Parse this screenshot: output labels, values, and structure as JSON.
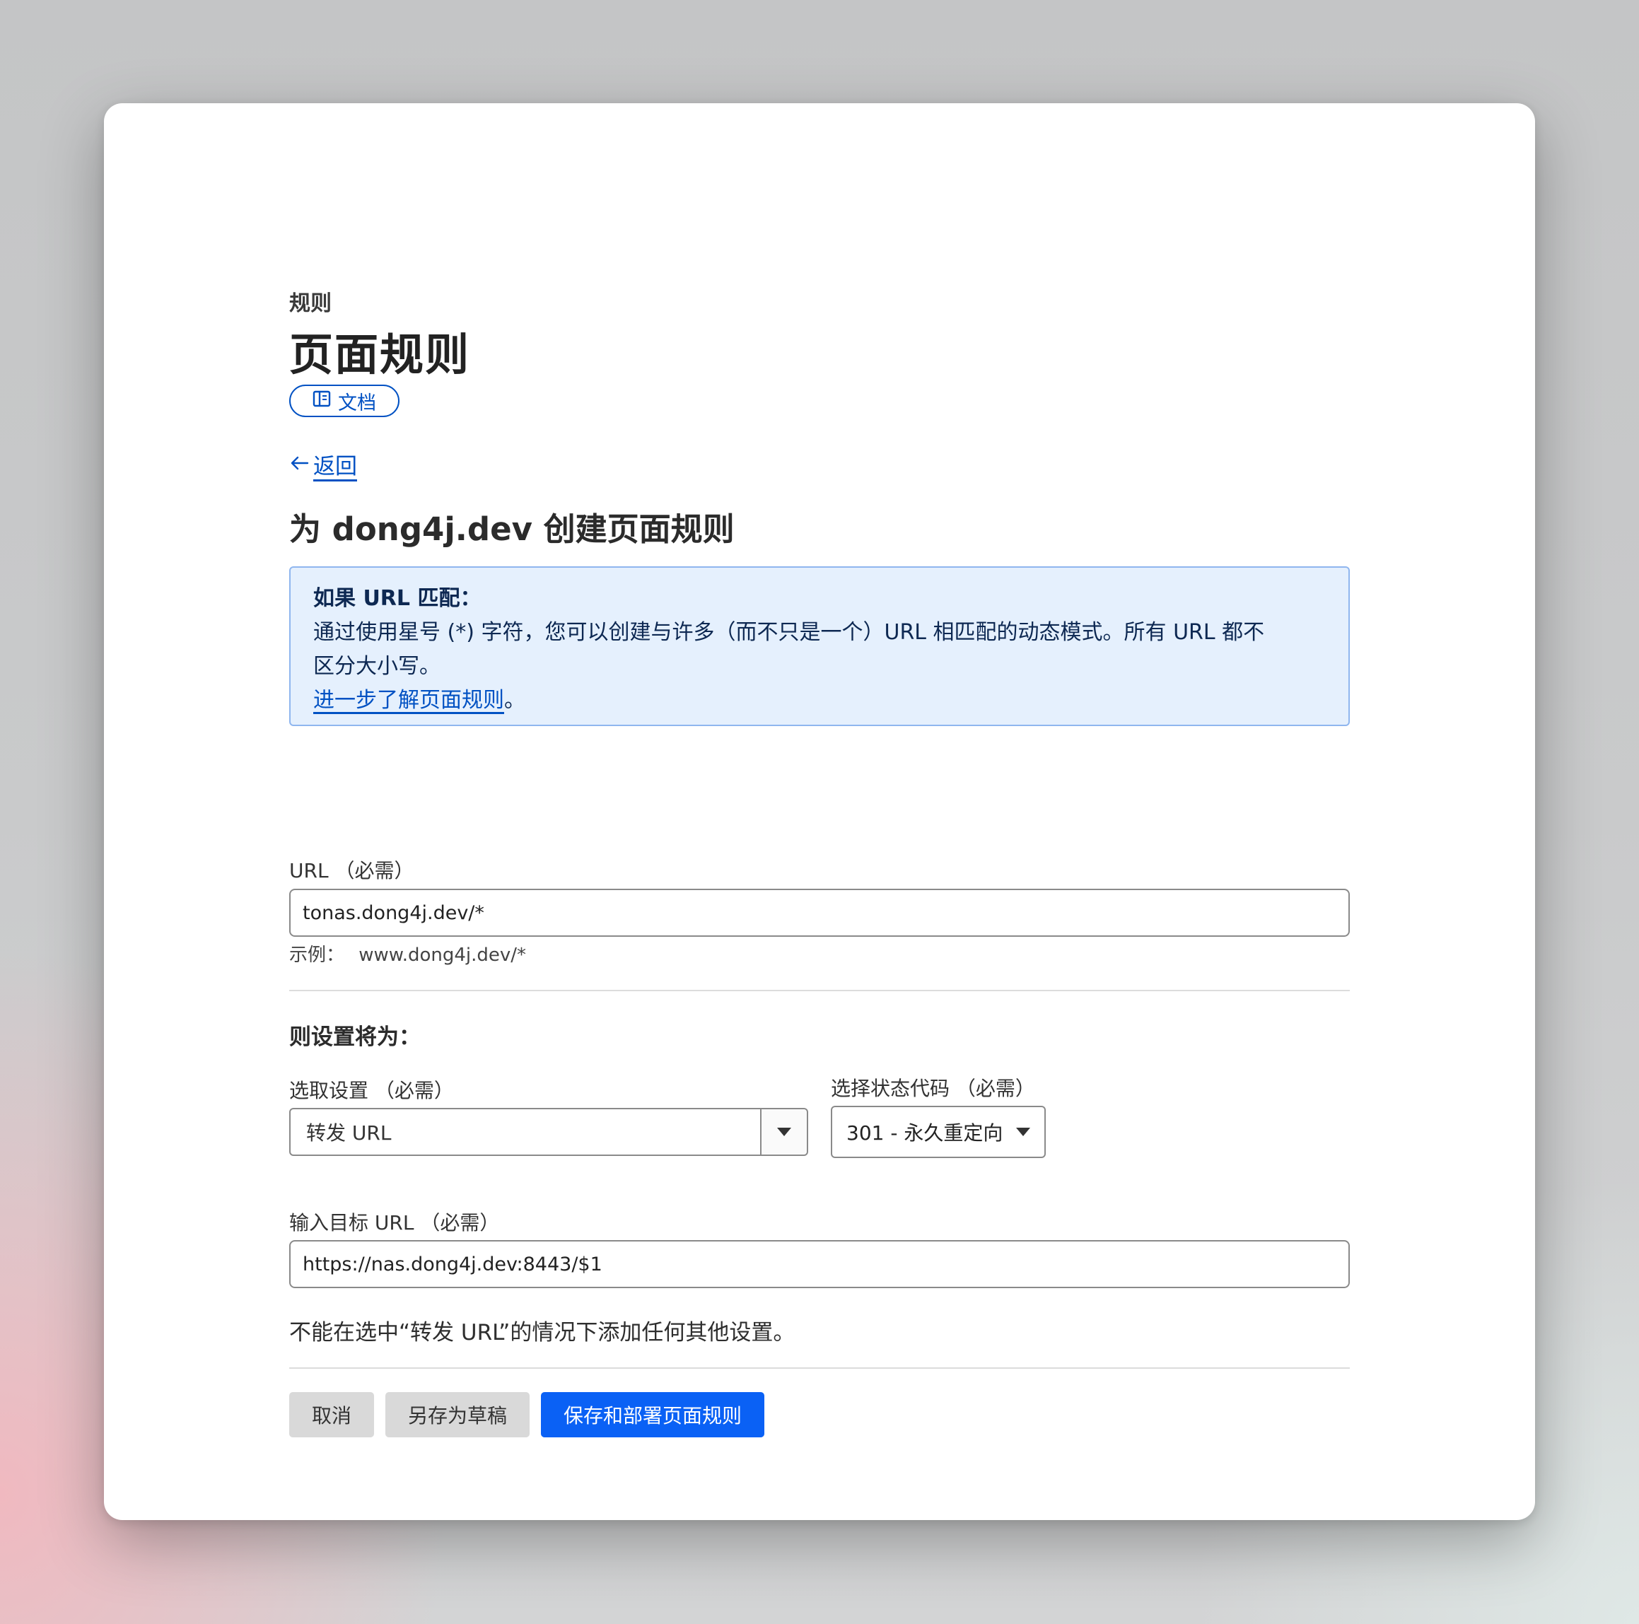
{
  "header": {
    "breadcrumb": "规则",
    "title": "页面规则",
    "docs_label": "文档",
    "back_label": "返回"
  },
  "form": {
    "heading": "为 dong4j.dev 创建页面规则",
    "info": {
      "title": "如果 URL 匹配：",
      "body_line1": "通过使用星号 (*) 字符，您可以创建与许多（而不只是一个）URL 相匹配的动态模式。所有 URL 都不",
      "body_line2": "区分大小写。",
      "link_text": "进一步了解页面规则",
      "link_suffix": "。"
    },
    "url": {
      "label": "URL （必需）",
      "value": "tonas.dong4j.dev/*",
      "example_prefix": "示例：",
      "example_value": "www.dong4j.dev/*"
    },
    "settings_heading": "则设置将为：",
    "setting": {
      "label": "选取设置 （必需）",
      "value": "转发 URL"
    },
    "status": {
      "label": "选择状态代码 （必需）",
      "value": "301 - 永久重定向"
    },
    "target": {
      "label": "输入目标 URL （必需）",
      "value": "https://nas.dong4j.dev:8443/$1"
    },
    "note": "不能在选中“转发 URL”的情况下添加任何其他设置。"
  },
  "actions": {
    "cancel": "取消",
    "save_draft": "另存为草稿",
    "save_deploy": "保存和部署页面规则"
  },
  "colors": {
    "accent": "#0051c3",
    "primary_button": "#0a61f5",
    "info_bg": "#e5f0fd"
  }
}
